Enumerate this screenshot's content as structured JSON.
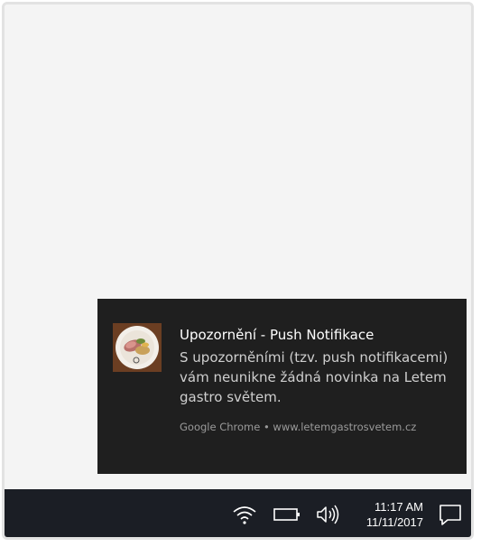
{
  "notification": {
    "title": "Upozornění - Push Notifikace",
    "body": "S upozorněními (tzv. push notifikacemi) vám neunikne žádná novinka na Letem gastro světem.",
    "source": "Google Chrome • www.letemgastrosvetem.cz",
    "image_icon": "food-plate-thumbnail"
  },
  "taskbar": {
    "time": "11:17 AM",
    "date": "11/11/2017",
    "icons": [
      "wifi-icon",
      "battery-icon",
      "volume-icon",
      "action-center-icon"
    ]
  },
  "colors": {
    "toast_bg": "#1f1f1f",
    "taskbar_bg": "#1b1e25",
    "desktop_bg": "#f4f4f4"
  }
}
